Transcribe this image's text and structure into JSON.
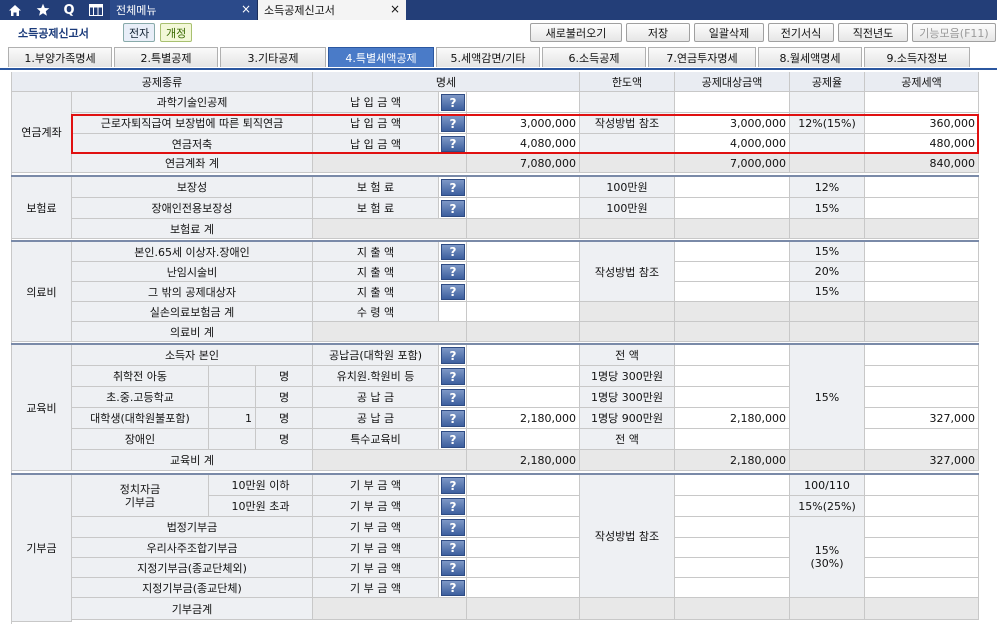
{
  "topbar": {
    "icons": [
      "home-icon",
      "star-icon",
      "search-icon",
      "menu-grid-icon"
    ],
    "search_glyph": "Q",
    "tabs": [
      {
        "label": "전체메뉴",
        "close": "×"
      },
      {
        "label": "소득공제신고서",
        "close": "×"
      }
    ]
  },
  "title_row": {
    "title": "소득공제신고서",
    "badge1": "전자",
    "badge2": "개정",
    "buttons": [
      "새로불러오기",
      "저장",
      "일괄삭제",
      "전기서식",
      "직전년도",
      "기능모음(F11)"
    ]
  },
  "tabs": [
    "1.부양가족명세",
    "2.특별공제",
    "3.기타공제",
    "4.특별세액공제",
    "5.세액감면/기타",
    "6.소득공제",
    "7.연금투자명세",
    "8.월세액명세",
    "9.소득자정보"
  ],
  "active_tab_index": 3,
  "help_glyph": "?",
  "header": {
    "type": "공제종류",
    "detail": "명세",
    "limit": "한도액",
    "target": "공제대상금액",
    "rate": "공제율",
    "deduction": "공제세액"
  },
  "pension": {
    "group": "연금계좌",
    "rows": [
      {
        "name": "과학기술인공제",
        "item": "납 입 금 액",
        "amount": "",
        "target": "",
        "rate": "",
        "deduction": ""
      },
      {
        "name": "근로자퇴직급여 보장법에 따른 퇴직연금",
        "item": "납 입 금 액",
        "amount": "3,000,000",
        "target": "3,000,000",
        "rate": "12%(15%)",
        "deduction": "360,000"
      },
      {
        "name": "연금저축",
        "item": "납 입 금 액",
        "amount": "4,080,000",
        "target": "4,000,000",
        "rate": "",
        "deduction": "480,000"
      }
    ],
    "limit_note": "작성방법 참조",
    "total_label": "연금계좌 계",
    "total_amount": "7,080,000",
    "total_target": "7,000,000",
    "total_deduction": "840,000"
  },
  "insurance": {
    "group": "보험료",
    "rows": [
      {
        "name": "보장성",
        "item": "보 험 료",
        "limit": "100만원",
        "rate": "12%"
      },
      {
        "name": "장애인전용보장성",
        "item": "보 험 료",
        "limit": "100만원",
        "rate": "15%"
      }
    ],
    "total_label": "보험료 계"
  },
  "medical": {
    "group": "의료비",
    "rows": [
      {
        "name": "본인.65세 이상자.장애인",
        "item": "지 출 액",
        "rate": "15%"
      },
      {
        "name": "난임시술비",
        "item": "지 출 액",
        "rate": "20%"
      },
      {
        "name": "그 밖의 공제대상자",
        "item": "지 출 액",
        "rate": "15%"
      },
      {
        "name": "실손의료보험금 계",
        "item": "수 령 액",
        "rate": ""
      }
    ],
    "limit_note": "작성방법 참조",
    "total_label": "의료비 계"
  },
  "education": {
    "group": "교육비",
    "self": {
      "name": "소득자 본인",
      "item": "공납금(대학원 포함)",
      "limit": "전 액"
    },
    "rows": [
      {
        "name": "취학전 아동",
        "count": "",
        "unit": "명",
        "item": "유치원.학원비 등",
        "limit": "1명당 300만원",
        "amount": "",
        "target": "",
        "deduction": ""
      },
      {
        "name": "초.중.고등학교",
        "count": "",
        "unit": "명",
        "item": "공 납 금",
        "limit": "1명당 300만원",
        "amount": "",
        "target": "",
        "deduction": ""
      },
      {
        "name": "대학생(대학원불포함)",
        "count": "1",
        "unit": "명",
        "item": "공 납 금",
        "limit": "1명당 900만원",
        "amount": "2,180,000",
        "target": "2,180,000",
        "deduction": "327,000"
      },
      {
        "name": "장애인",
        "count": "",
        "unit": "명",
        "item": "특수교육비",
        "limit": "전 액",
        "amount": "",
        "target": "",
        "deduction": ""
      }
    ],
    "rate": "15%",
    "total_label": "교육비 계",
    "total_amount": "2,180,000",
    "total_target": "2,180,000",
    "total_deduction": "327,000"
  },
  "donation": {
    "group": "기부금",
    "political": "정치자금\n기부금",
    "political_line1": "정치자금",
    "political_line2": "기부금",
    "political_rows": [
      {
        "sub": "10만원 이하",
        "item": "기 부 금 액",
        "rate": "100/110"
      },
      {
        "sub": "10만원 초과",
        "item": "기 부 금 액",
        "rate": "15%(25%)"
      }
    ],
    "rows": [
      {
        "name": "법정기부금",
        "item": "기 부 금 액"
      },
      {
        "name": "우리사주조합기부금",
        "item": "기 부 금 액"
      },
      {
        "name": "지정기부금(종교단체외)",
        "item": "기 부 금 액"
      },
      {
        "name": "지정기부금(종교단체)",
        "item": "기 부 금 액"
      }
    ],
    "limit_note": "작성방법 참조",
    "rate_line1": "15%",
    "rate_line2": "(30%)",
    "total_label": "기부금계"
  }
}
